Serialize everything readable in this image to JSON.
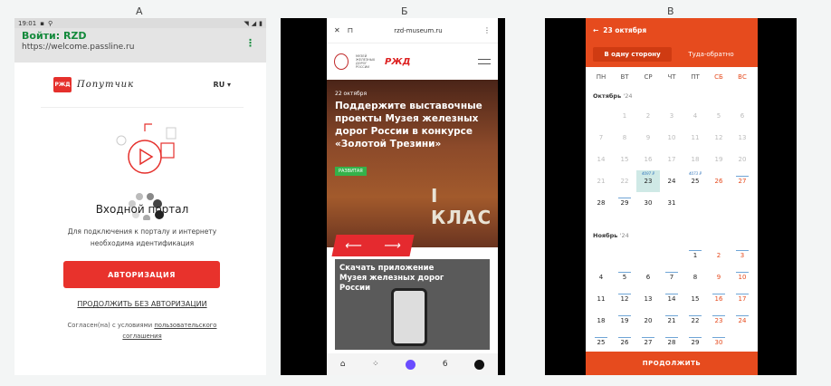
{
  "labels": {
    "a": "А",
    "b": "Б",
    "c": "В"
  },
  "panel_a": {
    "status_time": "19:01",
    "title": "Войти: RZD",
    "url": "https://welcome.passline.ru",
    "kebab": "⋮",
    "logo_text": "РЖД",
    "brand": "Попутчик",
    "lang": "RU ▾",
    "portal_title": "Входной портал",
    "description": "Для подключения к порталу и интернету необходима идентификация",
    "auth_button": "АВТОРИЗАЦИЯ",
    "skip_link": "ПРОДОЛЖИТЬ БЕЗ АВТОРИЗАЦИИ",
    "agree_prefix": "Согласен(на) с условиями ",
    "agree_link": "пользовательского соглашения"
  },
  "panel_b": {
    "close": "✕",
    "bookmark": "⊓",
    "url": "rzd-museum.ru",
    "kebab": "⋮",
    "logo_caption": "МУЗЕЙ ЖЕЛЕЗНЫХ ДОРОГ РОССИИ",
    "rzd": "РЖД",
    "date": "22 октября",
    "hero_title": "Поддержите выставочные проекты Музея железных дорог России в конкурсе «Золотой Трезини»",
    "tag": "РАЗВИТАЯ",
    "sign": "I КЛАС",
    "arrow_left": "⟵",
    "arrow_right": "⟶",
    "card_title": "Скачать приложение Музея железных дорог России",
    "nav_home": "⌂",
    "nav_grid": "⁘",
    "nav_tabs": "6"
  },
  "panel_c": {
    "back": "←",
    "date_title": "23 октября",
    "tab_one_way": "В одну сторону",
    "tab_round": "Туда-обратно",
    "weekdays": [
      "ПН",
      "ВТ",
      "СР",
      "ЧТ",
      "ПТ",
      "СБ",
      "ВС"
    ],
    "october": "Октябрь",
    "october_year": "'24",
    "november": "Ноябрь",
    "november_year": "'24",
    "price_wed": "4097 ₽",
    "price_fri": "4073 ₽",
    "continue": "ПРОДОЛЖИТЬ",
    "oct_rows": [
      [
        "",
        "1",
        "2",
        "3",
        "4",
        "5",
        "6"
      ],
      [
        "7",
        "8",
        "9",
        "10",
        "11",
        "12",
        "13"
      ],
      [
        "14",
        "15",
        "16",
        "17",
        "18",
        "19",
        "20"
      ],
      [
        "21",
        "22",
        "23",
        "24",
        "25",
        "26",
        "27"
      ],
      [
        "28",
        "29",
        "30",
        "31",
        "",
        "",
        ""
      ]
    ],
    "nov_rows": [
      [
        "",
        "",
        "",
        "",
        "1",
        "2",
        "3"
      ],
      [
        "4",
        "5",
        "6",
        "7",
        "8",
        "9",
        "10"
      ],
      [
        "11",
        "12",
        "13",
        "14",
        "15",
        "16",
        "17"
      ],
      [
        "18",
        "19",
        "20",
        "21",
        "22",
        "23",
        "24"
      ],
      [
        "25",
        "26",
        "27",
        "28",
        "29",
        "30",
        ""
      ]
    ]
  }
}
